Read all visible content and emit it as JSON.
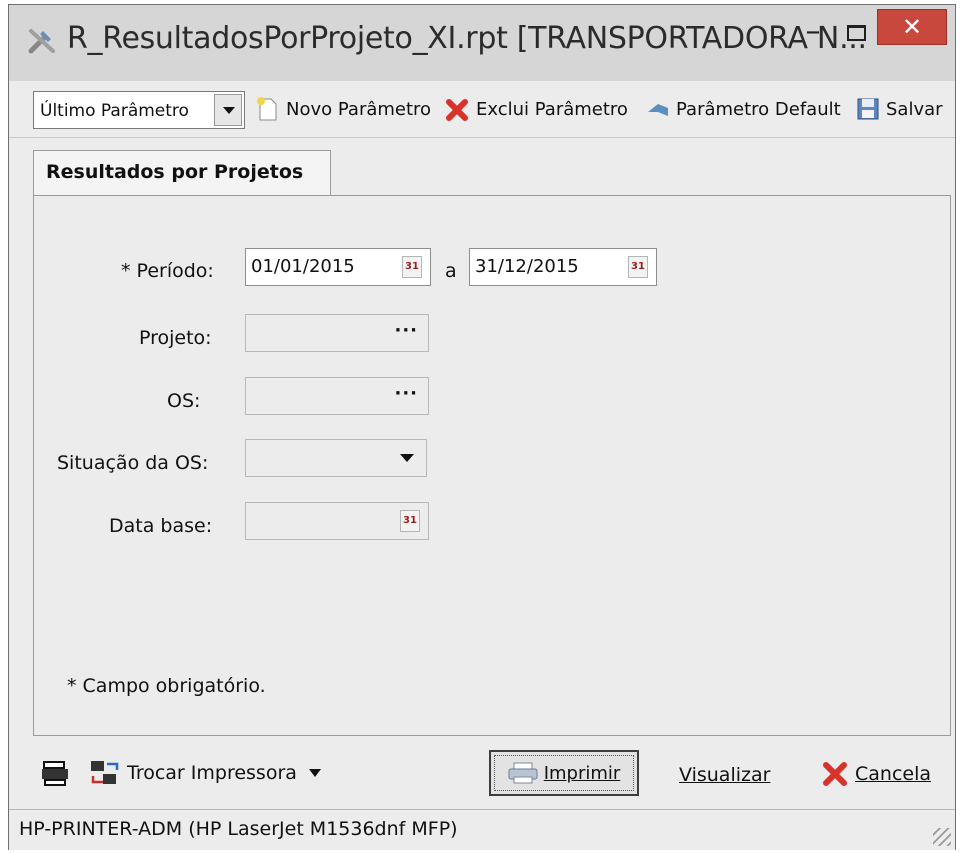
{
  "window": {
    "title": "R_ResultadosPorProjeto_XI.rpt [TRANSPORTADORA N...",
    "minimize": "–",
    "close": "✕"
  },
  "toolbar": {
    "combo_value": "Último Parâmetro",
    "novo": "Novo Parâmetro",
    "exclui": "Exclui Parâmetro",
    "default": "Parâmetro Default",
    "salvar": "Salvar"
  },
  "tab": {
    "label": "Resultados por Projetos"
  },
  "form": {
    "periodo_label": "* Período:",
    "periodo_start": "01/01/2015",
    "periodo_sep": "a",
    "periodo_end": "31/12/2015",
    "projeto_label": "Projeto:",
    "projeto_value": "",
    "os_label": "OS:",
    "os_value": "",
    "situacao_label": "Situação da OS:",
    "situacao_value": "",
    "database_label": "Data base:",
    "database_value": "",
    "required_note": "* Campo obrigatório.",
    "dots": "···",
    "cal_glyph": "31"
  },
  "bottom": {
    "trocar": "Trocar Impressora",
    "imprimir": "Imprimir",
    "visualizar": "Visualizar",
    "cancela": "Cancela"
  },
  "status": {
    "printer": "HP-PRINTER-ADM (HP LaserJet M1536dnf MFP)"
  }
}
